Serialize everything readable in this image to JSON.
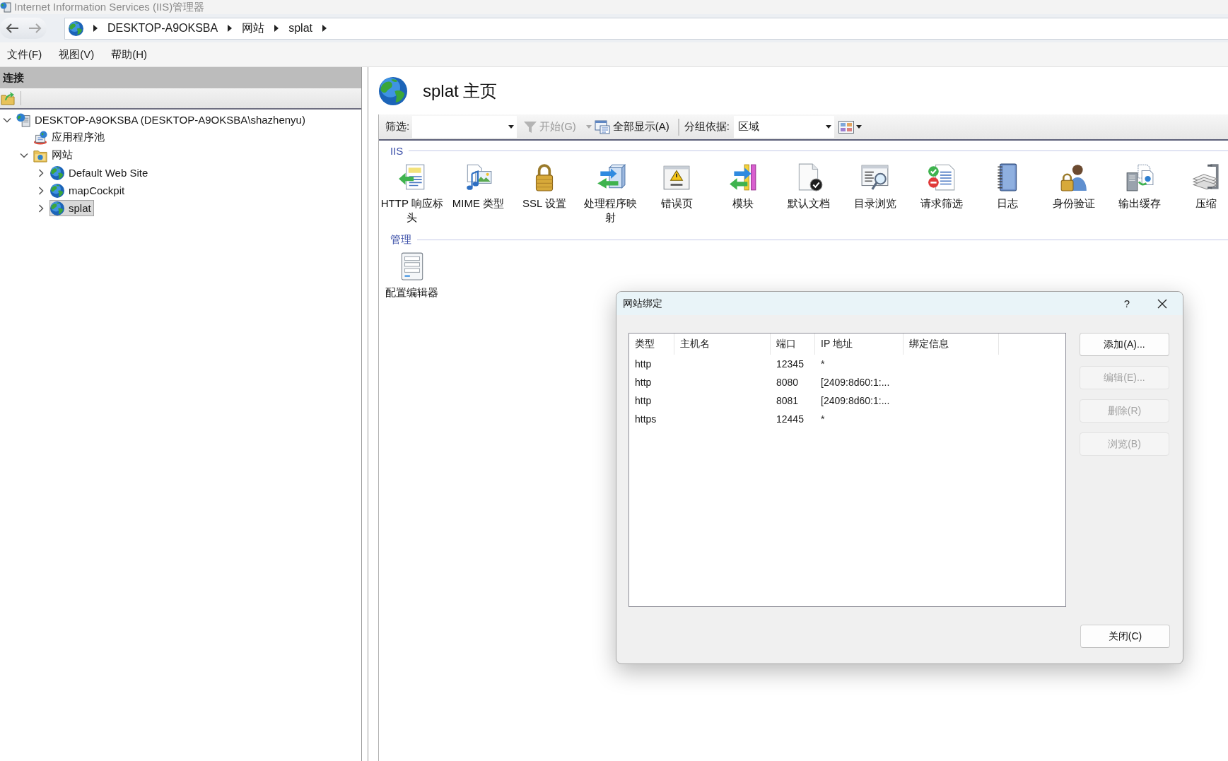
{
  "window": {
    "title": "Internet Information Services (IIS)管理器"
  },
  "address_bar": {
    "segments": [
      "DESKTOP-A9OKSBA",
      "网站",
      "splat"
    ]
  },
  "menu": [
    "文件(F)",
    "视图(V)",
    "帮助(H)"
  ],
  "connections": {
    "title": "连接",
    "tree": [
      {
        "label": "DESKTOP-A9OKSBA (DESKTOP-A9OKSBA\\shazhenyu)",
        "kind": "server",
        "expanded": true,
        "selected": false,
        "children": [
          {
            "label": "应用程序池",
            "kind": "app_pools",
            "selected": false
          },
          {
            "label": "网站",
            "kind": "sites",
            "expanded": true,
            "selected": false,
            "children": [
              {
                "label": "Default Web Site",
                "kind": "site",
                "expanded": false,
                "selected": false
              },
              {
                "label": "mapCockpit",
                "kind": "site",
                "expanded": false,
                "selected": false
              },
              {
                "label": "splat",
                "kind": "site",
                "expanded": false,
                "selected": true
              }
            ]
          }
        ]
      }
    ]
  },
  "home": {
    "title": "splat 主页",
    "toolbar": {
      "filter_label": "筛选:",
      "go_button": {
        "label": "开始(G)",
        "disabled": true
      },
      "show_all_button": {
        "label": "全部显示(A)"
      },
      "group_by_label": "分组依据:",
      "group_by": {
        "value": "区域"
      }
    },
    "groups": [
      {
        "title": "IIS",
        "features": [
          {
            "label": "HTTP 响应标头"
          },
          {
            "label": "MIME 类型"
          },
          {
            "label": "SSL 设置"
          },
          {
            "label": "处理程序映射"
          },
          {
            "label": "错误页"
          },
          {
            "label": "模块"
          },
          {
            "label": "默认文档"
          },
          {
            "label": "目录浏览"
          },
          {
            "label": "请求筛选"
          },
          {
            "label": "日志"
          },
          {
            "label": "身份验证"
          },
          {
            "label": "输出缓存"
          },
          {
            "label": "压缩"
          }
        ]
      },
      {
        "title": "管理",
        "features": [
          {
            "label": "配置编辑器"
          }
        ]
      }
    ]
  },
  "dialog": {
    "title": "网站绑定",
    "help": "?",
    "columns": [
      "类型",
      "主机名",
      "端口",
      "IP 地址",
      "绑定信息"
    ],
    "rows": [
      {
        "type": "http",
        "port": "12345",
        "ip_address": "*"
      },
      {
        "type": "http",
        "port": "8080",
        "ip_address": "[2409:8d60:1:..."
      },
      {
        "type": "http",
        "port": "8081",
        "ip_address": "[2409:8d60:1:..."
      },
      {
        "type": "https",
        "port": "12445",
        "ip_address": "*"
      }
    ],
    "buttons": [
      {
        "label": "添加(A)...",
        "disabled": false
      },
      {
        "label": "编辑(E)...",
        "disabled": true
      },
      {
        "label": "删除(R)",
        "disabled": true
      },
      {
        "label": "浏览(B)",
        "disabled": true
      }
    ],
    "close_button": {
      "label": "关闭(C)"
    }
  }
}
